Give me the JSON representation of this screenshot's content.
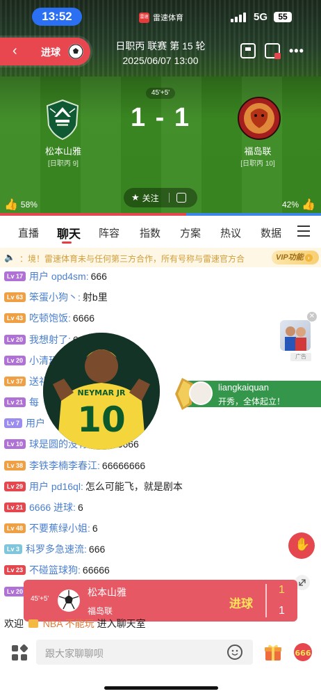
{
  "status_bar": {
    "time": "13:52",
    "network": "5G",
    "battery": "55"
  },
  "brand": {
    "logo_text": "雷速",
    "name": "雷速体育"
  },
  "goal_pill": {
    "label": "进球"
  },
  "match": {
    "competition": "日职丙 联赛 第 15 轮",
    "datetime": "2025/06/07 13:00",
    "minute": "45'+5'",
    "score": "1 - 1",
    "home": {
      "name": "松本山雅",
      "rank": "[日职丙 9]",
      "like_pct": "58%"
    },
    "away": {
      "name": "福岛联",
      "rank": "[日职丙 10]",
      "like_pct": "42%"
    },
    "follow_label": "关注",
    "home_like_fraction": 0.58
  },
  "tabs": [
    "直播",
    "聊天",
    "阵容",
    "指数",
    "方案",
    "热议",
    "数据"
  ],
  "active_tab": "聊天",
  "notice": {
    "text": "：境！雷速体育未与任何第三方合作，所有号称与雷速官方合",
    "vip_label": "VIP功能"
  },
  "chat": [
    {
      "lv": "Lv 17",
      "user": "用户 opd4sm:",
      "msg": "666",
      "color": "#b071d6"
    },
    {
      "lv": "Lv 63",
      "user": "笨蛋小狗丶:",
      "msg": "射b里",
      "color": "#f0a044"
    },
    {
      "lv": "Lv 43",
      "user": "吃顿饱饭:",
      "msg": "6666",
      "color": "#f0a044"
    },
    {
      "lv": "Lv 20",
      "user": "我想射了:",
      "msg": "666",
      "color": "#b071d6"
    },
    {
      "lv": "Lv 20",
      "user": "小清玩",
      "msg": "",
      "color": "#b071d6"
    },
    {
      "lv": "Lv 37",
      "user": "送礼",
      "msg": "",
      "color": "#f0a044"
    },
    {
      "lv": "Lv 21",
      "user": "每",
      "msg": "",
      "color": "#b071d6"
    },
    {
      "lv": "Lv 7",
      "user": "用户",
      "msg": "",
      "color": "#9b8df0"
    },
    {
      "lv": "Lv 10",
      "user": "球是圆的没有绝对:",
      "msg": "66666",
      "color": "#b071d6"
    },
    {
      "lv": "Lv 38",
      "user": "李铁李楠李春江:",
      "msg": "66666666",
      "color": "#f0a044"
    },
    {
      "lv": "Lv 29",
      "user": "用户 pd16ql:",
      "msg": "怎么可能飞，就是剧本",
      "color": "#e5474f"
    },
    {
      "lv": "Lv 21",
      "user": "6666 进球:",
      "msg": "6",
      "color": "#e5474f"
    },
    {
      "lv": "Lv 48",
      "user": "不要蕉绿小姐:",
      "msg": "6",
      "color": "#f0a044"
    },
    {
      "lv": "Lv 3",
      "user": "科罗多急速流:",
      "msg": "666",
      "color": "#7fc6dd"
    },
    {
      "lv": "Lv 23",
      "user": "不碰篮球狗:",
      "msg": "66666",
      "color": "#e5474f"
    },
    {
      "lv": "Lv 20",
      "user": "",
      "msg": "",
      "color": "#b071d6"
    }
  ],
  "avatar_overlay": {
    "jersey_name": "NEYMAR JR",
    "jersey_number": "10"
  },
  "ad": {
    "label": "广告"
  },
  "entry_banner": {
    "user": "liangkaiquan",
    "text": "开秀，全体起立！"
  },
  "goal_card": {
    "minute": "45'+5'",
    "home": "松本山雅",
    "away": "福岛联",
    "label": "进球",
    "home_score": "1",
    "away_score": "1"
  },
  "welcome": {
    "prefix": "欢迎",
    "user": "NBA 不能玩",
    "suffix": "进入聊天室"
  },
  "input": {
    "placeholder": "跟大家聊聊呗"
  },
  "colors": {
    "accent": "#e43e44",
    "pitch": "#3a8921",
    "goal_card": "#e65864"
  }
}
